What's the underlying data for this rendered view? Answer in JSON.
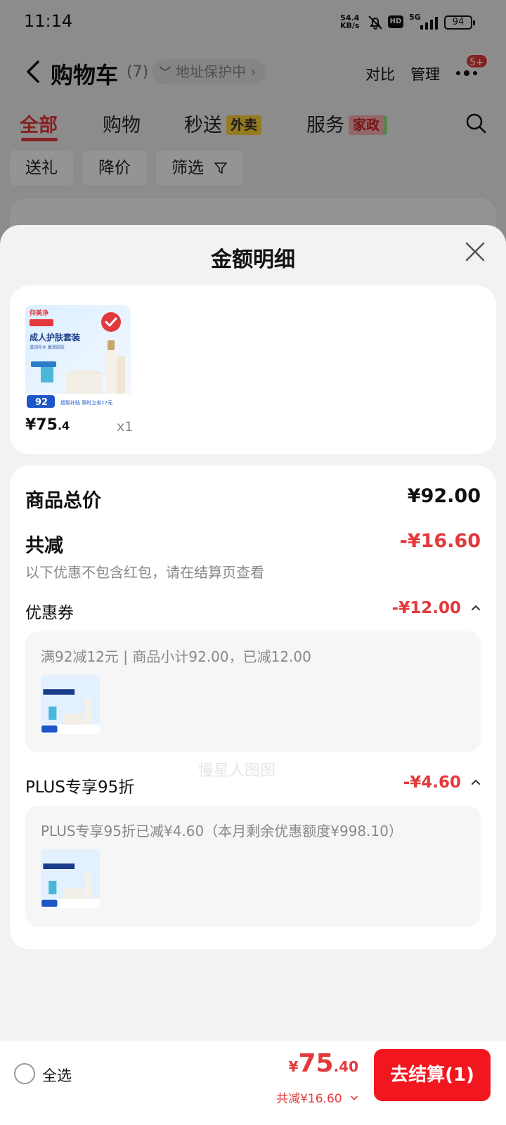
{
  "status_bar": {
    "time": "11:14",
    "net_speed_value": "54.4",
    "net_speed_unit": "KB/s",
    "hd_label": "HD",
    "signal_label": "5G",
    "battery": "94"
  },
  "header": {
    "title": "购物车",
    "count": "(7)",
    "address_protect": "地址保护中 ›",
    "compare_label": "对比",
    "manage_label": "管理",
    "notification_badge": "5+"
  },
  "tabs": [
    {
      "label": "全部"
    },
    {
      "label": "购物"
    },
    {
      "label": "秒送",
      "tag": "外卖"
    },
    {
      "label": "服务",
      "tag": "家政"
    }
  ],
  "chips": [
    {
      "label": "送礼"
    },
    {
      "label": "降价"
    },
    {
      "label": "筛选"
    }
  ],
  "sheet": {
    "title": "金额明细",
    "product": {
      "brand": "仰美净",
      "name": "成人护肤套装",
      "sub": "滋润补水 嫩滑肌肤",
      "promo_price": "92",
      "promo_text": "超级补贴 限时立省17元",
      "price_int": "¥75",
      "price_frac": ".4",
      "qty": "x1"
    },
    "detail": {
      "total_label": "商品总价",
      "total_value": "¥92.00",
      "discount_label": "共减",
      "discount_value": "-¥16.60",
      "note": "以下优惠不包含红包，请在结算页查看",
      "coupon_label": "优惠券",
      "coupon_value": "-¥12.00",
      "coupon_desc": "满92减12元 | 商品小计92.00，已减12.00",
      "plus_label": "PLUS专享95折",
      "plus_value": "-¥4.60",
      "plus_desc": "PLUS专享95折已减¥4.60（本月剩余优惠额度¥998.10）"
    },
    "watermark": "慢星人图图"
  },
  "bottom_bar": {
    "select_all": "全选",
    "currency": "¥",
    "total_int": "75",
    "total_frac": ".40",
    "total_discount": "共减¥16.60",
    "checkout": "去结算(1)"
  },
  "colors": {
    "accent": "#e4393c",
    "checkout": "#f2161f"
  }
}
